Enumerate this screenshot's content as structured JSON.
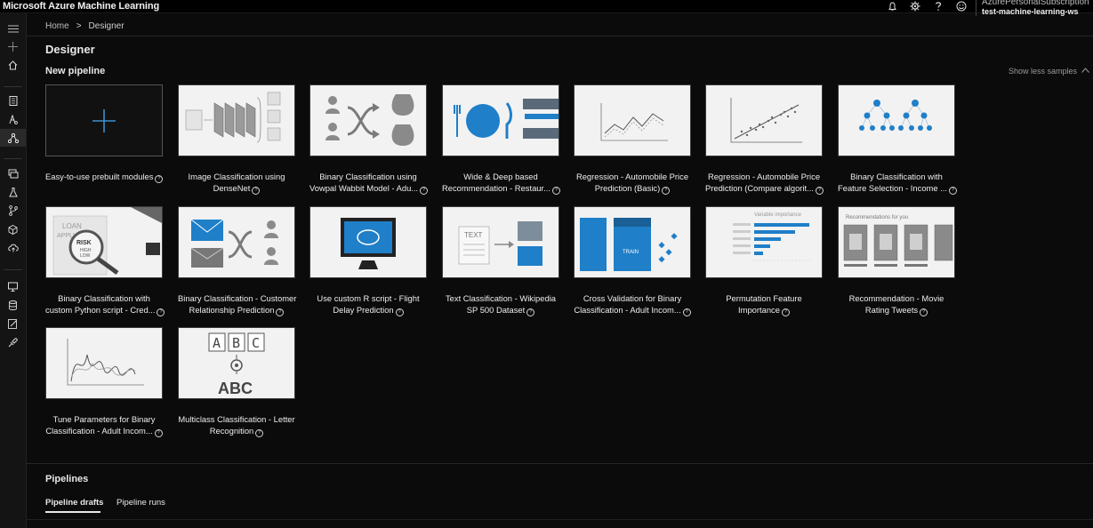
{
  "app": {
    "title": "Microsoft Azure Machine Learning",
    "subscription": "AzurePersonalSubscription",
    "workspace": "test-machine-learning-ws"
  },
  "topbar_icons": [
    "bell-icon",
    "gear-icon",
    "help-icon",
    "smiley-icon"
  ],
  "breadcrumb": {
    "home": "Home",
    "separator": ">",
    "current": "Designer"
  },
  "page": {
    "title": "Designer",
    "new_pipeline": "New pipeline",
    "show_less": "Show less samples"
  },
  "cards": [
    {
      "line1": "Easy-to-use prebuilt modules",
      "line2": ""
    },
    {
      "line1": "Image Classification using",
      "line2": "DenseNet"
    },
    {
      "line1": "Binary Classification using",
      "line2": "Vowpal Wabbit Model - Adu..."
    },
    {
      "line1": "Wide & Deep based",
      "line2": "Recommendation - Restaur..."
    },
    {
      "line1": "Regression - Automobile Price",
      "line2": "Prediction (Basic)"
    },
    {
      "line1": "Regression - Automobile Price",
      "line2": "Prediction (Compare algorit..."
    },
    {
      "line1": "Binary Classification with",
      "line2": "Feature Selection - Income ..."
    },
    {
      "line1": "Binary Classification with",
      "line2": "custom Python script - Cred..."
    },
    {
      "line1": "Binary Classification - Customer",
      "line2": "Relationship Prediction"
    },
    {
      "line1": "Use custom R script - Flight",
      "line2": "Delay Prediction"
    },
    {
      "line1": "Text Classification - Wikipedia",
      "line2": "SP 500 Dataset"
    },
    {
      "line1": "Cross Validation for Binary",
      "line2": "Classification - Adult Incom..."
    },
    {
      "line1": "Permutation Feature",
      "line2": "Importance"
    },
    {
      "line1": "Recommendation - Movie",
      "line2": "Rating Tweets"
    },
    {
      "line1": "Tune Parameters for Binary",
      "line2": "Classification - Adult Incom..."
    },
    {
      "line1": "Multiclass Classification - Letter",
      "line2": "Recognition"
    }
  ],
  "thumb_text": {
    "python_loan": "LOAN",
    "python_app": "APPLI",
    "python_risk": "RISK",
    "python_high": "HIGH",
    "python_low": "LOW",
    "text_label": "TEXT",
    "cv_label": "TRAIN",
    "perm_title": "Variable importance",
    "rec_title": "Recommendations for you",
    "letters": [
      "A",
      "B",
      "C"
    ],
    "letters_big": "ABC"
  },
  "pipelines": {
    "title": "Pipelines",
    "tabs": [
      "Pipeline drafts",
      "Pipeline runs"
    ]
  }
}
